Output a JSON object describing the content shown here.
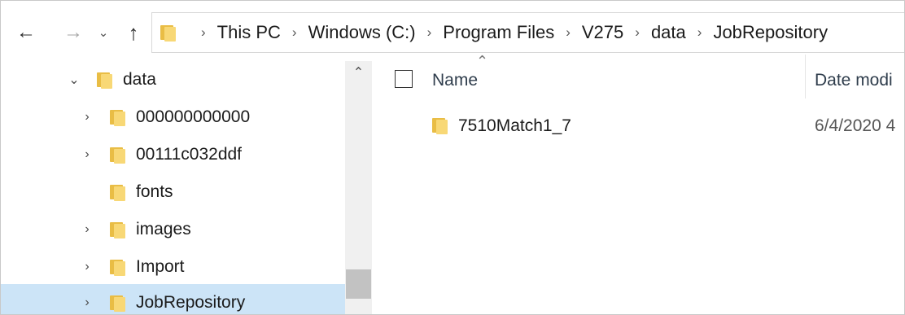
{
  "breadcrumb": [
    "This PC",
    "Windows (C:)",
    "Program Files",
    "V275",
    "data",
    "JobRepository"
  ],
  "tree": [
    {
      "label": "data",
      "expanded": true,
      "has_children": true
    },
    {
      "label": "000000000000",
      "has_children": true
    },
    {
      "label": "00111c032ddf",
      "has_children": true
    },
    {
      "label": "fonts",
      "has_children": false
    },
    {
      "label": "images",
      "has_children": true
    },
    {
      "label": "Import",
      "has_children": true
    },
    {
      "label": "JobRepository",
      "has_children": true,
      "selected": true
    }
  ],
  "columns": {
    "name": "Name",
    "date": "Date modi"
  },
  "files": [
    {
      "name": "7510Match1_7",
      "date": "6/4/2020 4"
    }
  ],
  "icons": {
    "back": "back-arrow-icon",
    "forward": "forward-arrow-icon",
    "recent": "chevron-down-icon",
    "up": "up-arrow-icon",
    "folder": "folder-icon"
  },
  "colors": {
    "selection": "#cce4f7",
    "folder": "#f8d876"
  }
}
